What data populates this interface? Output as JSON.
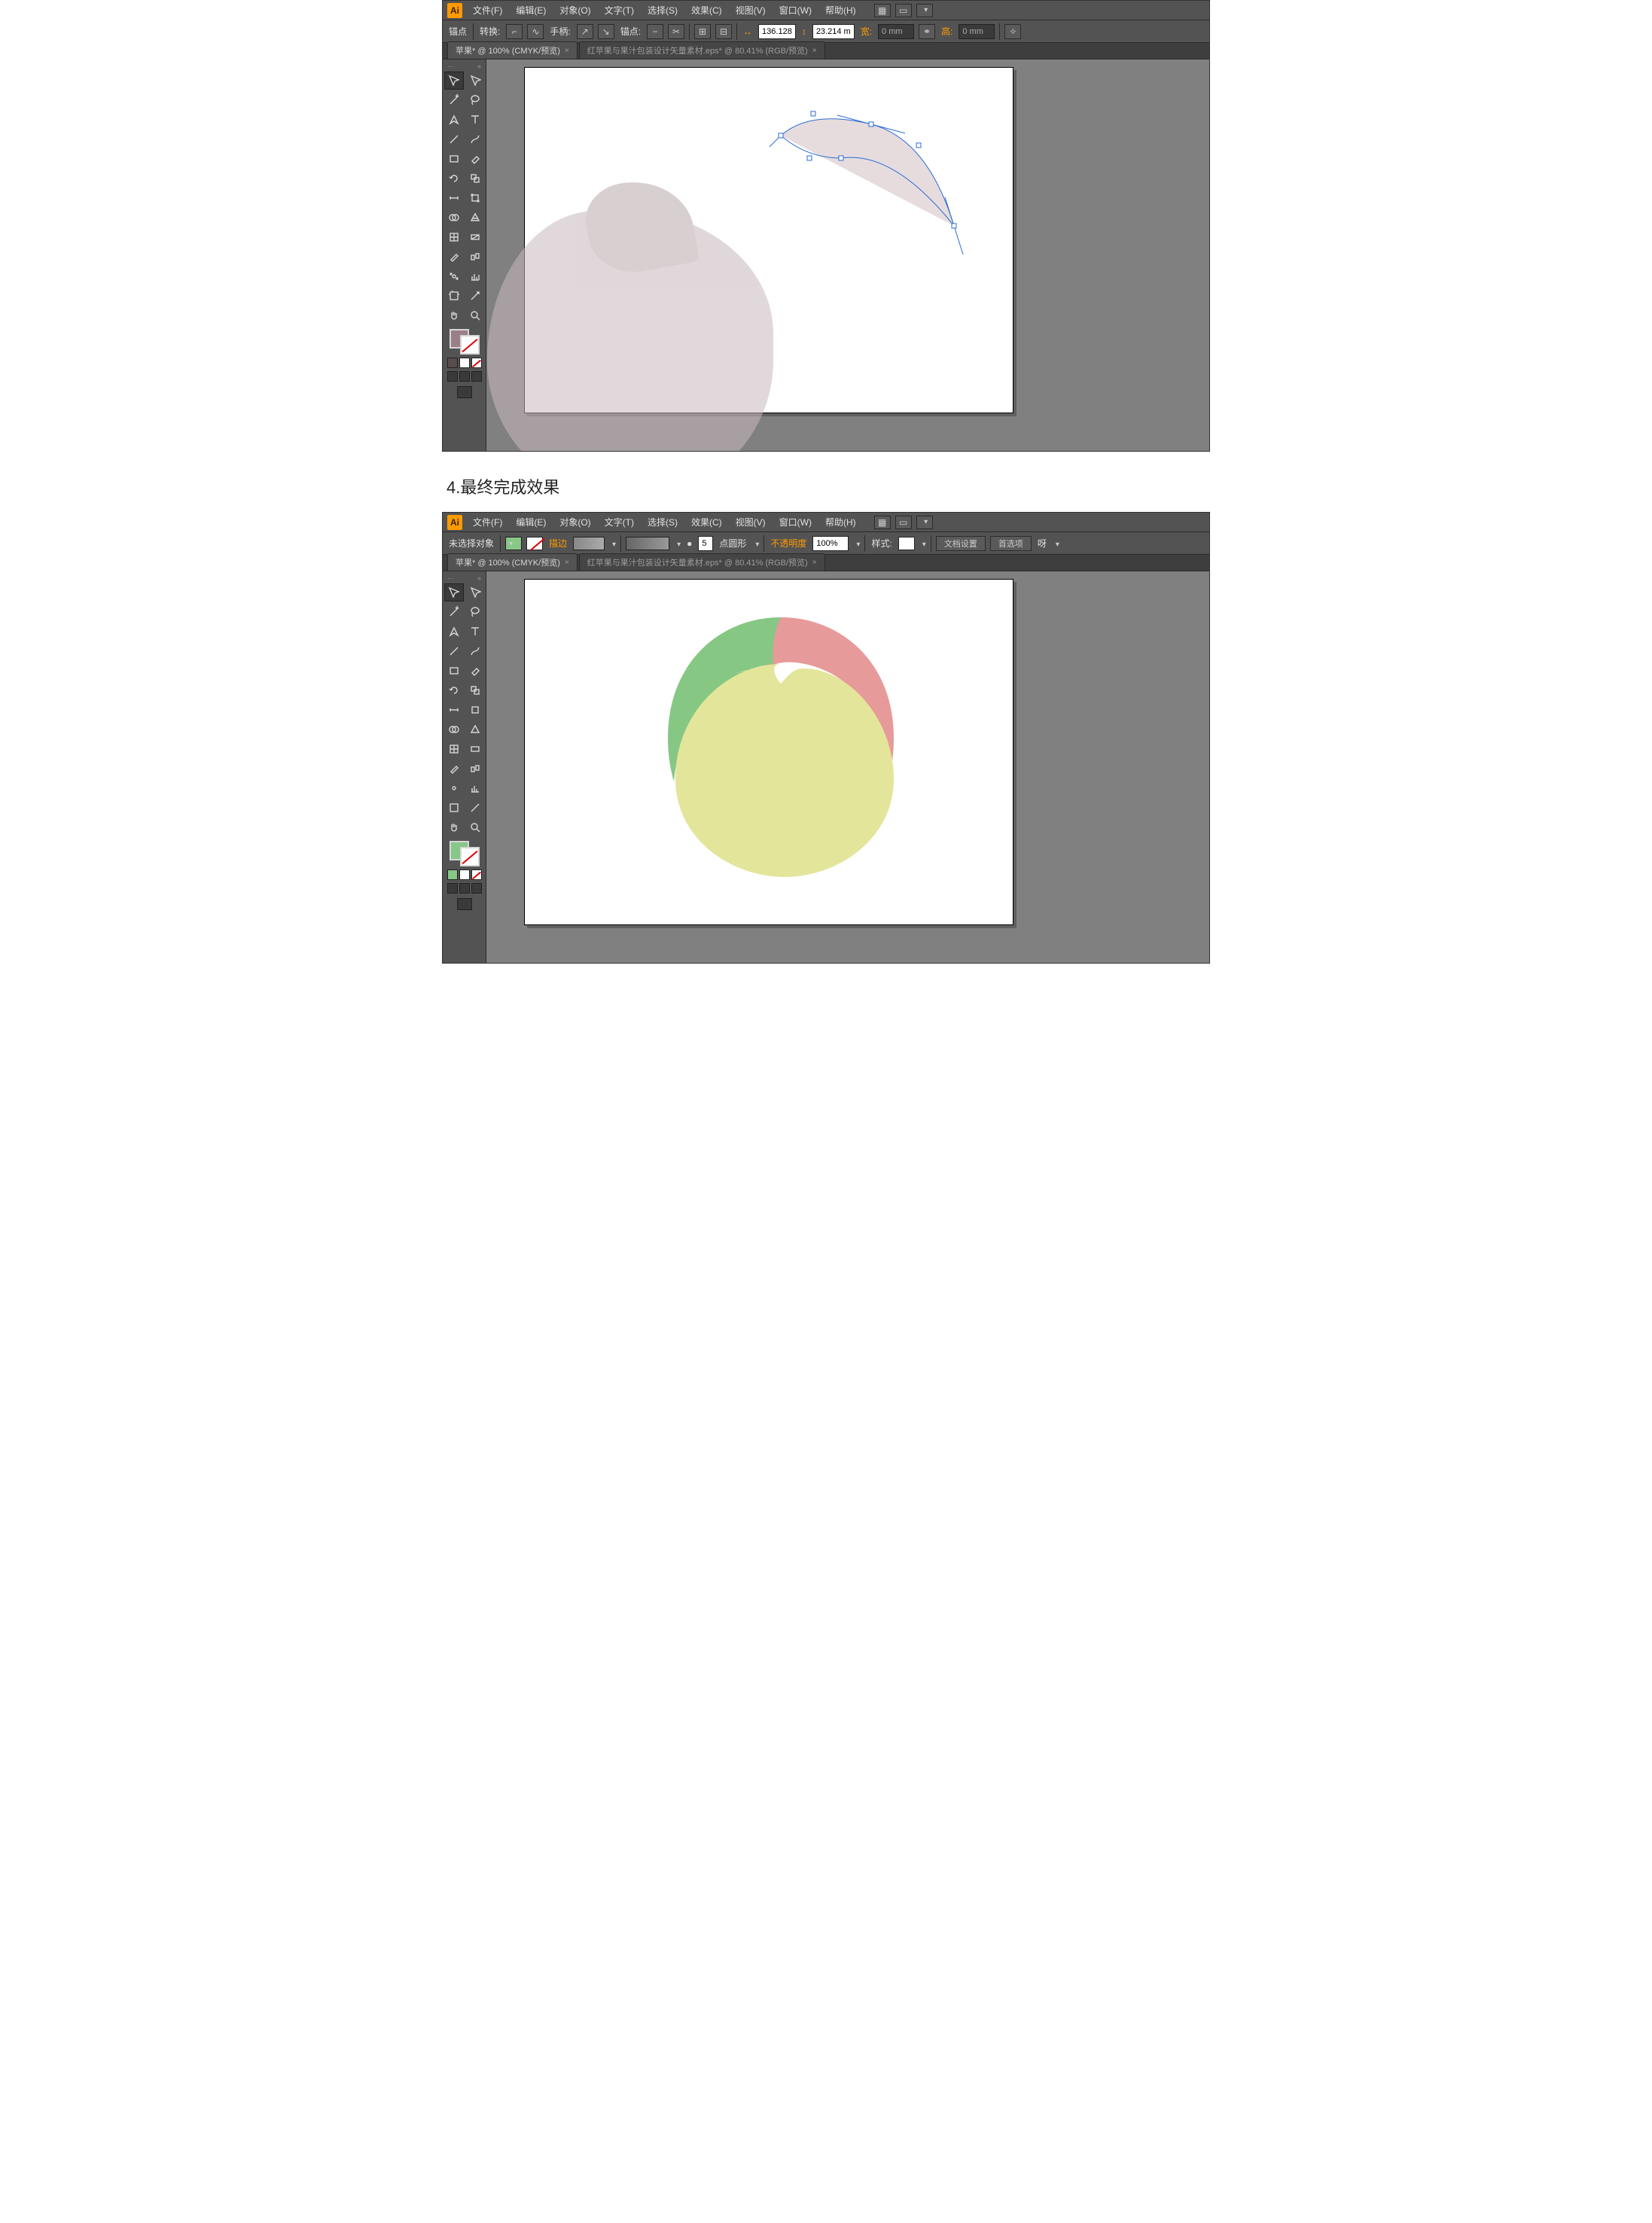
{
  "caption": "4.最终完成效果",
  "app_logo": "Ai",
  "menus": [
    "文件(F)",
    "编辑(E)",
    "对象(O)",
    "文字(T)",
    "选择(S)",
    "效果(C)",
    "视图(V)",
    "窗口(W)",
    "帮助(H)"
  ],
  "menubar_right_icons": [
    "grid-icon",
    "layout-icon",
    "dropdown-icon"
  ],
  "shot1": {
    "ctrl": {
      "label_anchor": "锚点",
      "label_convert": "转换:",
      "label_handle": "手柄:",
      "label_anchor2": "锚点:",
      "w_label": "宽",
      "w_value": "136.128",
      "h_label": "高",
      "h_value": "23.214 m",
      "x_field": "0 mm",
      "y_field": "0 mm",
      "link_icon": "link-icon",
      "label_w2": "宽:",
      "label_h2": "高:"
    },
    "tabs": [
      {
        "label": "苹果* @ 100% (CMYK/预览)",
        "active": true
      },
      {
        "label": "红苹果与果汁包装设计矢量素材.eps* @ 80.41% (RGB/预览)",
        "active": false
      }
    ],
    "fill_color": "#9a7f87"
  },
  "shot2": {
    "ctrl": {
      "label_nosel": "未选择对象",
      "label_stroke": "描边",
      "pt_value": "5",
      "pt_label": "点圆形",
      "label_opacity": "不透明度",
      "opacity_value": "100%",
      "label_style": "样式:",
      "btn_docsetup": "文档设置",
      "btn_prefs": "首选项",
      "label_align": "呀"
    },
    "tabs": [
      {
        "label": "苹果* @ 100% (CMYK/预览)",
        "active": true
      },
      {
        "label": "红苹果与果汁包装设计矢量素材.eps* @ 80.41% (RGB/预览)",
        "active": false
      }
    ],
    "fill_color": "#87c787"
  },
  "tool_names_col1": [
    "selection",
    "magic-wand",
    "pen",
    "line",
    "rect",
    "shape-builder",
    "mesh",
    "eyedropper",
    "symbol",
    "artboard",
    "hand"
  ],
  "tool_names_col2": [
    "direct-selection",
    "lasso",
    "type",
    "brush",
    "ellipse",
    "scissors",
    "gradient",
    "blend",
    "graph",
    "slice",
    "zoom"
  ]
}
